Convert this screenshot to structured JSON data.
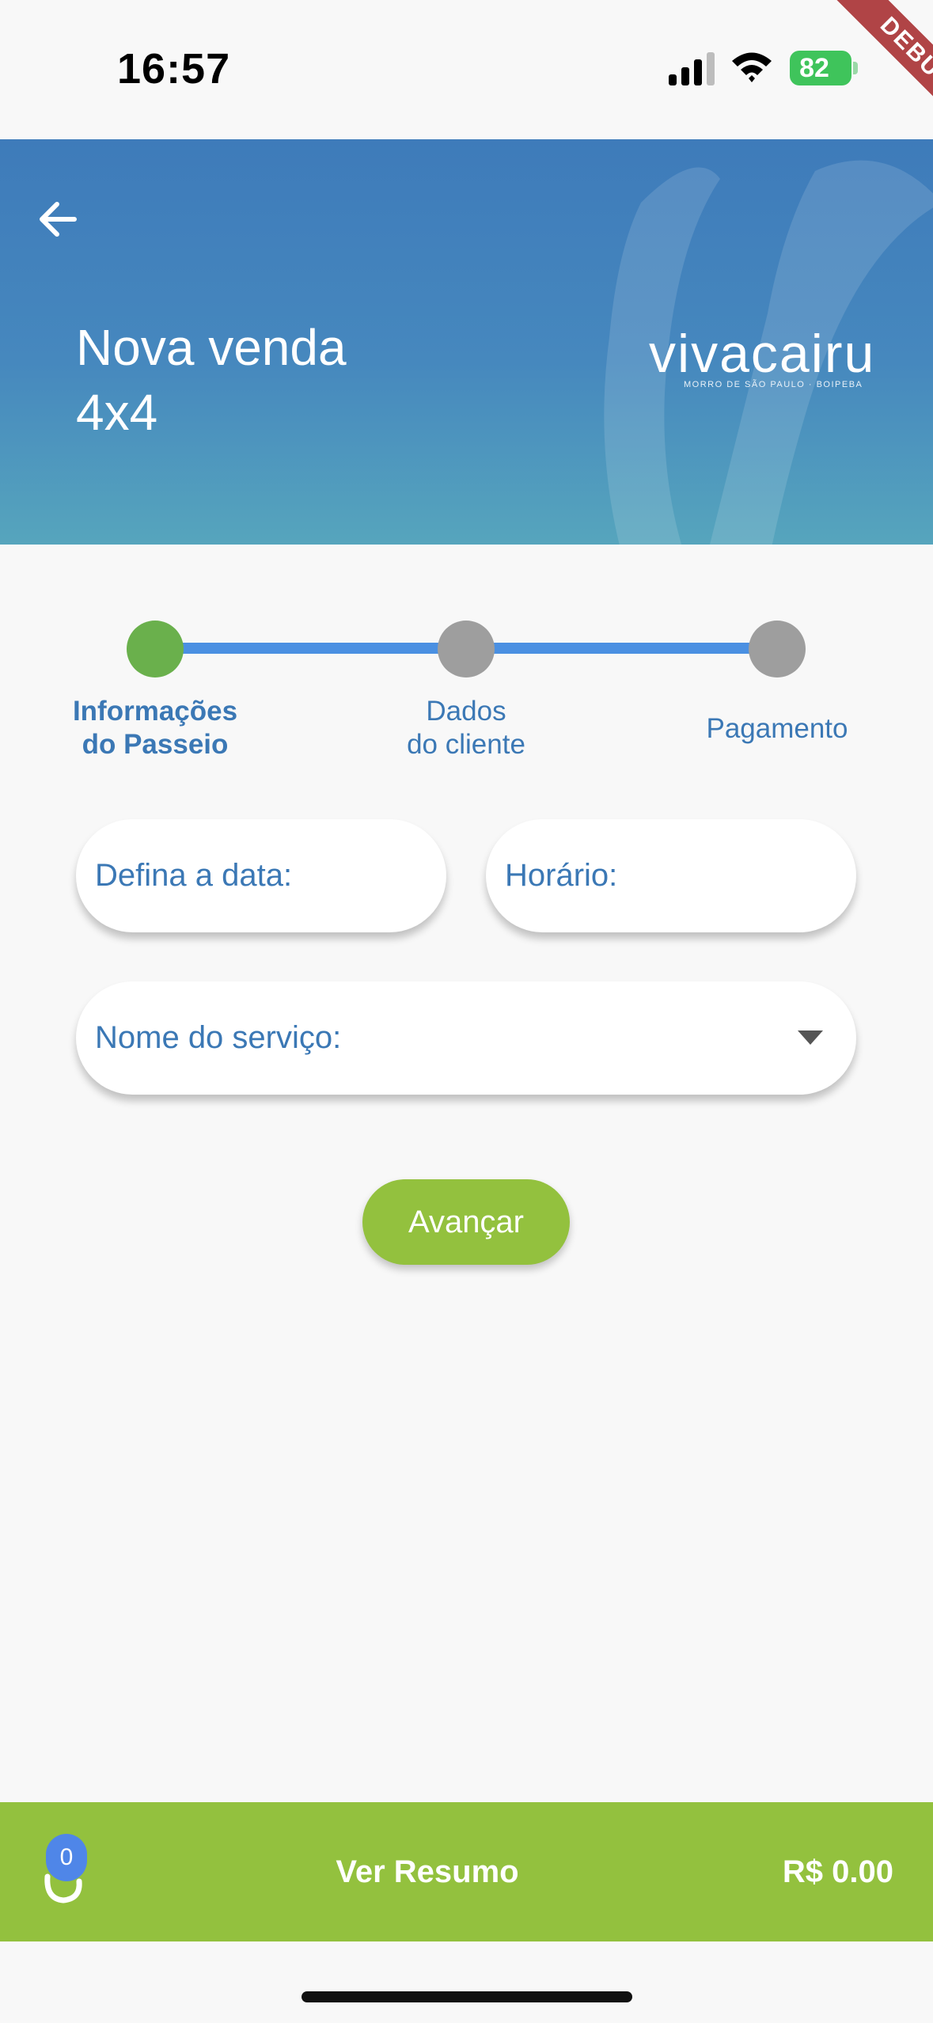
{
  "status_bar": {
    "time": "16:57",
    "battery": "82"
  },
  "debug_banner": "DEBUG",
  "header": {
    "title_line1": "Nova venda",
    "title_line2": "4x4",
    "logo_text": "vivacairu",
    "logo_subtext": "MORRO DE SÃO PAULO · BOIPEBA"
  },
  "stepper": {
    "steps": [
      {
        "line1": "Informações",
        "line2": "do Passeio",
        "state": "active"
      },
      {
        "line1": "Dados",
        "line2": "do cliente",
        "state": "pending"
      },
      {
        "line1": "Pagamento",
        "line2": "",
        "state": "pending"
      }
    ]
  },
  "form": {
    "date_label": "Defina a data:",
    "time_label": "Horário:",
    "service_label": "Nome do serviço:",
    "advance_label": "Avançar"
  },
  "bottom_bar": {
    "cart_count": "0",
    "summary_label": "Ver Resumo",
    "total": "R$ 0.00"
  },
  "colors": {
    "primary_blue": "#3e7bba",
    "accent_green": "#93c13e",
    "step_active": "#6ab04c",
    "step_pending": "#9e9e9e",
    "step_line": "#4a90e2",
    "label_blue": "#3b78b5"
  }
}
